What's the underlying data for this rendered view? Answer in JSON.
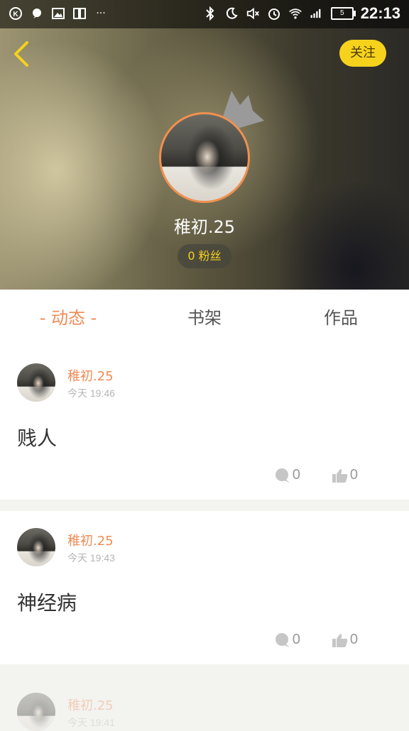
{
  "status_bar": {
    "left_icons": [
      "k-icon",
      "chat-icon",
      "image-icon",
      "book-icon",
      "more-icon"
    ],
    "more_text": "···",
    "battery": "5",
    "time": "22:13"
  },
  "header": {
    "follow_label": "关注",
    "username": "稚初.25",
    "fans": "0 粉丝"
  },
  "tabs": [
    {
      "label": "- 动态 -"
    },
    {
      "label": "书架"
    },
    {
      "label": "作品"
    }
  ],
  "feed": [
    {
      "name": "稚初.25",
      "time": "今天 19:46",
      "text": "贱人",
      "comments": "0",
      "likes": "0"
    },
    {
      "name": "稚初.25",
      "time": "今天 19:43",
      "text": "神经病",
      "comments": "0",
      "likes": "0"
    },
    {
      "name": "稚初.25",
      "time": "今天 19:41"
    }
  ],
  "colors": {
    "accent": "#f08b55",
    "follow_button": "#f6d21c",
    "fans_text": "#f6d21c"
  }
}
